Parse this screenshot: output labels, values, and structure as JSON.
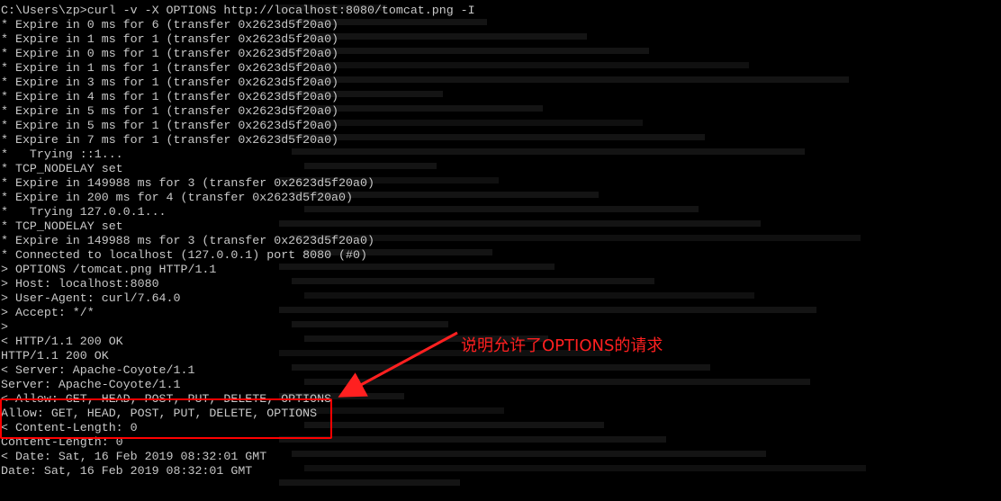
{
  "terminal": {
    "lines": [
      "C:\\Users\\zp>curl -v -X OPTIONS http://localhost:8080/tomcat.png -I",
      "* Expire in 0 ms for 6 (transfer 0x2623d5f20a0)",
      "* Expire in 1 ms for 1 (transfer 0x2623d5f20a0)",
      "* Expire in 0 ms for 1 (transfer 0x2623d5f20a0)",
      "* Expire in 1 ms for 1 (transfer 0x2623d5f20a0)",
      "* Expire in 3 ms for 1 (transfer 0x2623d5f20a0)",
      "* Expire in 4 ms for 1 (transfer 0x2623d5f20a0)",
      "* Expire in 5 ms for 1 (transfer 0x2623d5f20a0)",
      "* Expire in 5 ms for 1 (transfer 0x2623d5f20a0)",
      "* Expire in 7 ms for 1 (transfer 0x2623d5f20a0)",
      "*   Trying ::1...",
      "* TCP_NODELAY set",
      "* Expire in 149988 ms for 3 (transfer 0x2623d5f20a0)",
      "* Expire in 200 ms for 4 (transfer 0x2623d5f20a0)",
      "*   Trying 127.0.0.1...",
      "* TCP_NODELAY set",
      "* Expire in 149988 ms for 3 (transfer 0x2623d5f20a0)",
      "* Connected to localhost (127.0.0.1) port 8080 (#0)",
      "> OPTIONS /tomcat.png HTTP/1.1",
      "> Host: localhost:8080",
      "> User-Agent: curl/7.64.0",
      "> Accept: */*",
      ">",
      "< HTTP/1.1 200 OK",
      "HTTP/1.1 200 OK",
      "< Server: Apache-Coyote/1.1",
      "Server: Apache-Coyote/1.1",
      "< Allow: GET, HEAD, POST, PUT, DELETE, OPTIONS",
      "Allow: GET, HEAD, POST, PUT, DELETE, OPTIONS",
      "< Content-Length: 0",
      "Content-Length: 0",
      "< Date: Sat, 16 Feb 2019 08:32:01 GMT",
      "Date: Sat, 16 Feb 2019 08:32:01 GMT"
    ]
  },
  "annotation": {
    "text": "说明允许了OPTIONS的请求"
  },
  "colors": {
    "background": "#000000",
    "text": "#c8c8c8",
    "highlight": "#ff0000"
  }
}
